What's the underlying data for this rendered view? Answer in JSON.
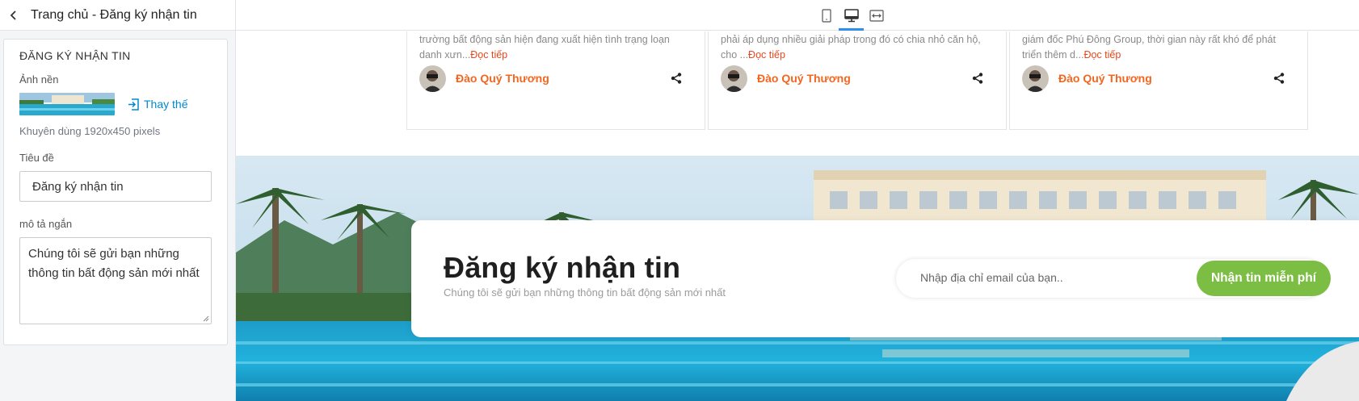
{
  "header": {
    "title": "Trang chủ - Đăng ký nhận tin"
  },
  "panel": {
    "title": "ĐĂNG KÝ NHẬN TIN",
    "background_label": "Ảnh nền",
    "replace_label": "Thay thế",
    "hint": "Khuyên dùng 1920x450 pixels",
    "title_label": "Tiêu đề",
    "title_value": "Đăng ký nhận tin",
    "desc_label": "mô tả ngắn",
    "desc_value": "Chúng tôi sẽ gửi bạn những thông tin bất động sản mới nhất"
  },
  "toolbar": {
    "devices": [
      "mobile-icon",
      "desktop-icon",
      "fullwidth-icon"
    ],
    "active_device": "desktop"
  },
  "cards": [
    {
      "line1": "trường bất động sản hiện đang xuất hiện tình trạng loạn",
      "line2": "danh xưn...",
      "read_more": "Đọc tiếp",
      "author": "Đào Quý Thương"
    },
    {
      "line1": "phải áp dụng nhiều giải pháp trong đó có chia nhỏ căn hộ,",
      "line2": "cho ...",
      "read_more": "Đọc tiếp",
      "author": "Đào Quý Thương"
    },
    {
      "line1": "giám đốc Phú Đông Group, thời gian này rất khó để phát",
      "line2": "triển thêm d...",
      "read_more": "Đọc tiếp",
      "author": "Đào Quý Thương"
    }
  ],
  "newsletter": {
    "title": "Đăng ký nhận tin",
    "subtitle": "Chúng tôi sẽ gửi bạn những thông tin bất động sản mới nhất",
    "email_placeholder": "Nhập địa chỉ email của bạn..",
    "button": "Nhận tin miễn phí"
  },
  "colors": {
    "accent_orange": "#f2661f",
    "read_more_red": "#e8471c",
    "button_green": "#7cbd43",
    "link_blue": "#0088cc",
    "active_tab_blue": "#2f8ef0"
  }
}
